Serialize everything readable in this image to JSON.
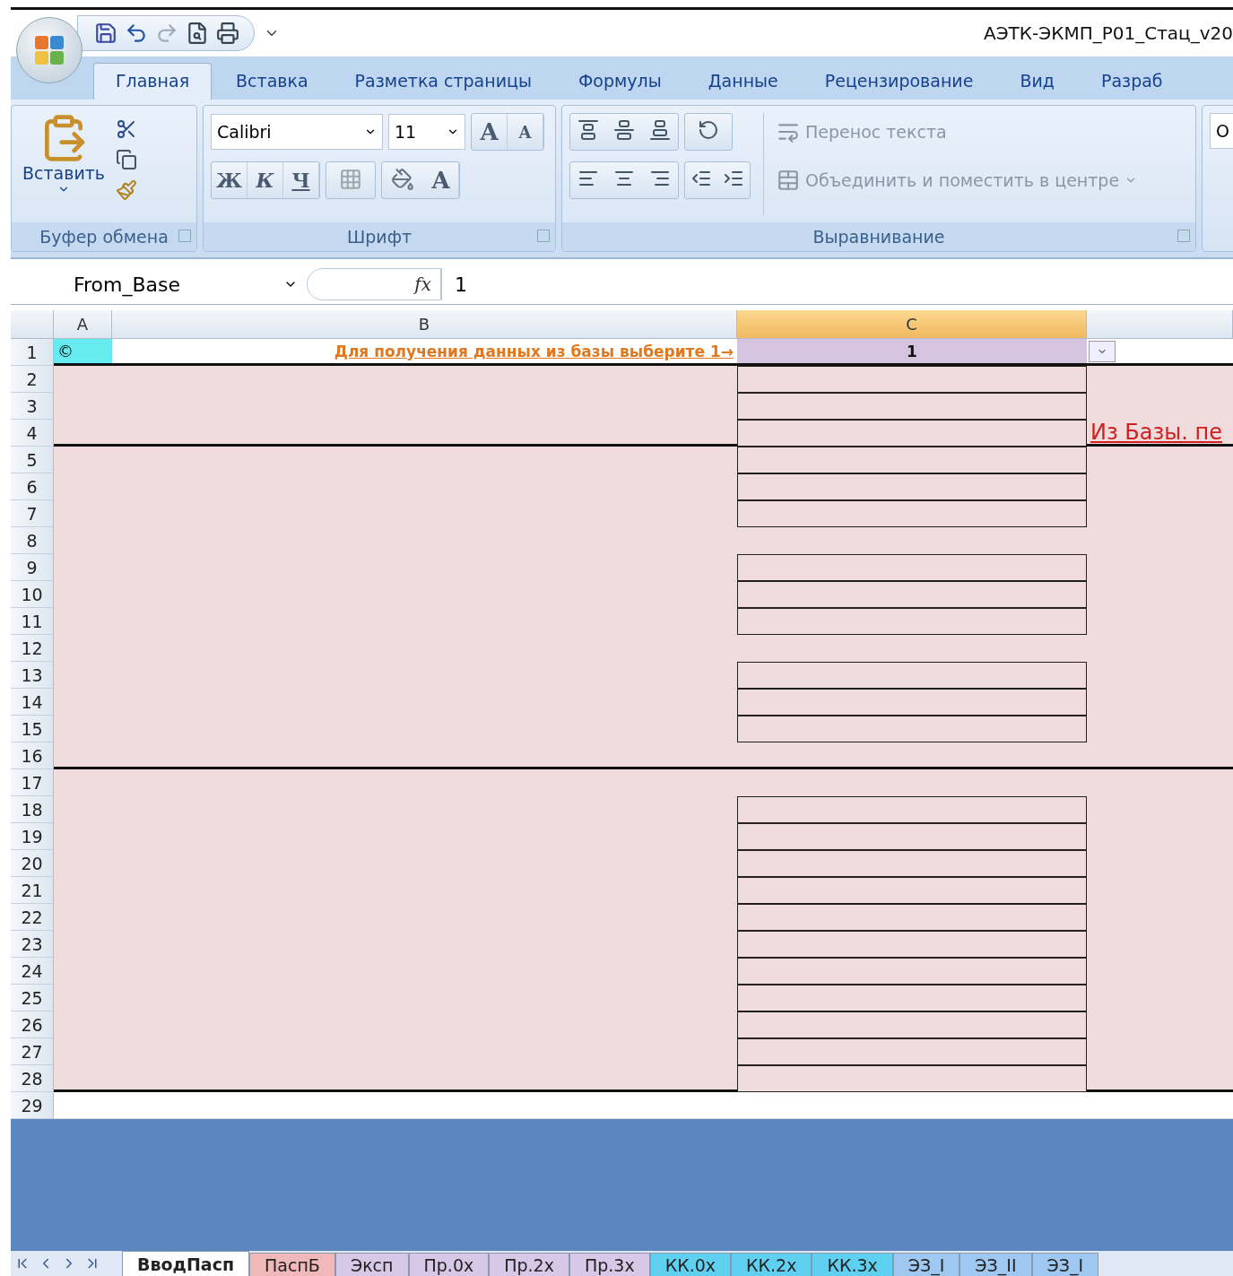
{
  "window": {
    "title": "АЭТК-ЭКМП_Р01_Стац_v20"
  },
  "ribbon_tabs": [
    {
      "label": "Главная",
      "selected": true
    },
    {
      "label": "Вставка",
      "selected": false
    },
    {
      "label": "Разметка страницы",
      "selected": false
    },
    {
      "label": "Формулы",
      "selected": false
    },
    {
      "label": "Данные",
      "selected": false
    },
    {
      "label": "Рецензирование",
      "selected": false
    },
    {
      "label": "Вид",
      "selected": false
    },
    {
      "label": "Разраб",
      "selected": false
    }
  ],
  "clipboard": {
    "paste_label": "Вставить",
    "group_label": "Буфер обмена"
  },
  "font": {
    "name": "Calibri",
    "size": "11",
    "grow": "A",
    "shrink": "A",
    "bold": "Ж",
    "italic": "К",
    "underline": "Ч",
    "color_letter": "A",
    "group_label": "Шрифт"
  },
  "alignment": {
    "wrap": "Перенос текста",
    "merge": "Объединить и поместить в центре",
    "group_label": "Выравнивание"
  },
  "next_group": {
    "field_text": "О"
  },
  "formula_bar": {
    "name_box": "From_Base",
    "fx": "fx",
    "value": "1"
  },
  "columns": [
    {
      "label": "A",
      "selected": false
    },
    {
      "label": "B",
      "selected": false
    },
    {
      "label": "C",
      "selected": true
    }
  ],
  "rows": [
    {
      "number": "1",
      "a": "©",
      "b": "Для получения данных  из базы выберите 1→",
      "c": "1",
      "boxed": false
    },
    {
      "number": "2",
      "boxed": true
    },
    {
      "number": "3",
      "boxed": true
    },
    {
      "number": "4",
      "boxed": true,
      "d": "Из Базы. пе"
    },
    {
      "number": "5",
      "boxed": true
    },
    {
      "number": "6",
      "boxed": true
    },
    {
      "number": "7",
      "boxed": true
    },
    {
      "number": "8",
      "boxed": false
    },
    {
      "number": "9",
      "boxed": true
    },
    {
      "number": "10",
      "boxed": true
    },
    {
      "number": "11",
      "boxed": true
    },
    {
      "number": "12",
      "boxed": false
    },
    {
      "number": "13",
      "boxed": true
    },
    {
      "number": "14",
      "boxed": true
    },
    {
      "number": "15",
      "boxed": true
    },
    {
      "number": "16",
      "boxed": false
    },
    {
      "number": "17",
      "boxed": false
    },
    {
      "number": "18",
      "boxed": true
    },
    {
      "number": "19",
      "boxed": true
    },
    {
      "number": "20",
      "boxed": true
    },
    {
      "number": "21",
      "boxed": true
    },
    {
      "number": "22",
      "boxed": true
    },
    {
      "number": "23",
      "boxed": true
    },
    {
      "number": "24",
      "boxed": true
    },
    {
      "number": "25",
      "boxed": true
    },
    {
      "number": "26",
      "boxed": true
    },
    {
      "number": "27",
      "boxed": true
    },
    {
      "number": "28",
      "boxed": true
    },
    {
      "number": "29",
      "boxed": false
    }
  ],
  "sheet_tabs": [
    {
      "label": "ВводПасп",
      "selected": true,
      "color": "#ffffff"
    },
    {
      "label": "ПаспБ",
      "selected": false,
      "color": "#f0b8b8"
    },
    {
      "label": "Эксп",
      "selected": false,
      "color": "#d8c8e8"
    },
    {
      "label": "Пр.0х",
      "selected": false,
      "color": "#d8c8e8"
    },
    {
      "label": "Пр.2х",
      "selected": false,
      "color": "#d8c8e8"
    },
    {
      "label": "Пр.3х",
      "selected": false,
      "color": "#d8c8e8"
    },
    {
      "label": "КК.0х",
      "selected": false,
      "color": "#5fd0f0"
    },
    {
      "label": "КК.2х",
      "selected": false,
      "color": "#5fd0f0"
    },
    {
      "label": "КК.3х",
      "selected": false,
      "color": "#5fd0f0"
    },
    {
      "label": "ЭЗ_I",
      "selected": false,
      "color": "#9ec8f0"
    },
    {
      "label": "ЭЗ_II",
      "selected": false,
      "color": "#9ec8f0"
    },
    {
      "label": "ЭЗ_I",
      "selected": false,
      "color": "#9ec8f0"
    }
  ]
}
